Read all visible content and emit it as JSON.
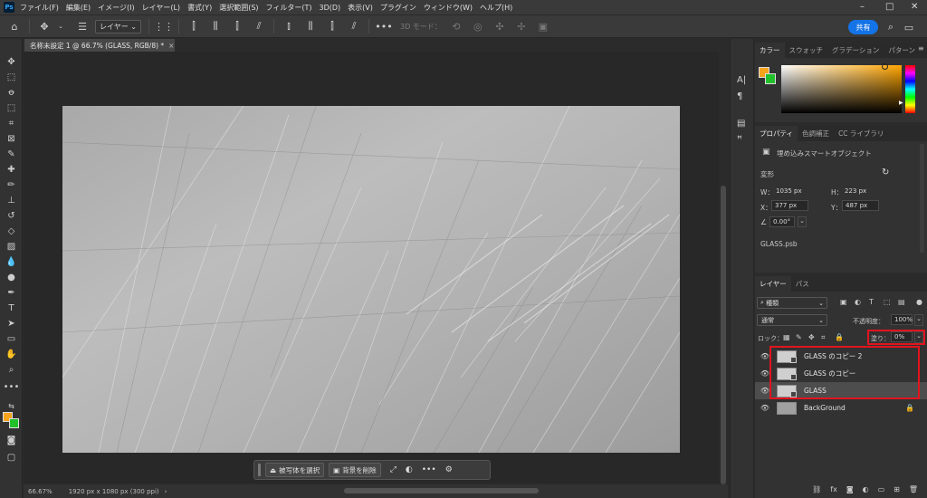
{
  "app": {
    "logo": "Ps"
  },
  "menu": [
    "ファイル(F)",
    "編集(E)",
    "イメージ(I)",
    "レイヤー(L)",
    "書式(Y)",
    "選択範囲(S)",
    "フィルター(T)",
    "3D(D)",
    "表示(V)",
    "プラグイン",
    "ウィンドウ(W)",
    "ヘルプ(H)"
  ],
  "options": {
    "auto_select_target": "レイヤー",
    "mode_3d": "3D モード：",
    "share": "共有"
  },
  "document": {
    "tab_title": "名称未設定 1 @ 66.7% (GLASS, RGB/8) *",
    "zoom": "66.67%",
    "info": "1920 px x 1080 px (300 ppi)"
  },
  "taskbar": {
    "select_subject": "被写体を選択",
    "remove_bg": "背景を削除"
  },
  "color_panel": {
    "tabs": [
      "カラー",
      "スウォッチ",
      "グラデーション",
      "パターン"
    ],
    "fg_color": "#f7a21b",
    "bg_color": "#22c02b"
  },
  "properties": {
    "tabs": [
      "プロパティ",
      "色調補正",
      "CC ライブラリ"
    ],
    "kind": "埋め込みスマートオブジェクト",
    "transform": "変形",
    "w_label": "W：",
    "w": "1035 px",
    "h_label": "H：",
    "h": "223 px",
    "x_label": "X：",
    "x": "377 px",
    "y_label": "Y：",
    "y": "487 px",
    "angle": "0.00°",
    "file": "GLASS.psb"
  },
  "layers_panel": {
    "tabs": [
      "レイヤー",
      "パス"
    ],
    "filter": "種類",
    "blend": "通常",
    "opacity_label": "不透明度：",
    "opacity": "100%",
    "lock_label": "ロック：",
    "fill_label": "塗り：",
    "fill": "0%",
    "layers": [
      {
        "name": "GLASS のコピー 2"
      },
      {
        "name": "GLASS のコピー"
      },
      {
        "name": "GLASS"
      },
      {
        "name": "BackGround"
      }
    ]
  }
}
